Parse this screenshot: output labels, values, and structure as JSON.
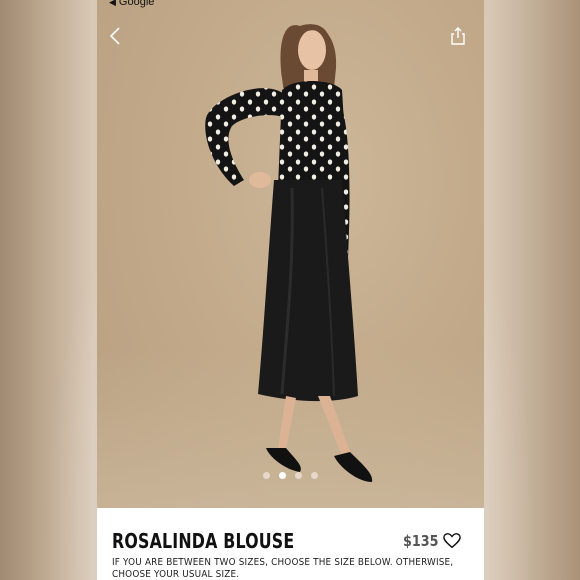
{
  "status_bar": {
    "back_app": "Google"
  },
  "product": {
    "title": "ROSALINDA BLOUSE",
    "price": "$135",
    "size_note": "IF YOU ARE BETWEEN TWO SIZES, CHOOSE THE SIZE BELOW. OTHERWISE, CHOOSE YOUR USUAL SIZE."
  },
  "carousel": {
    "count": 4,
    "active_index": 1
  },
  "icons": {
    "back": "chevron-left-icon",
    "share": "share-icon",
    "wishlist": "heart-icon"
  },
  "colors": {
    "accent_text": "#111111",
    "price_text": "#555555"
  }
}
